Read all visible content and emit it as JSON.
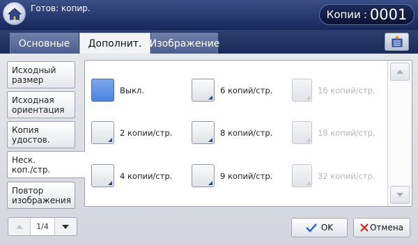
{
  "header": {
    "status": "Готов: копир.",
    "copies_label": "Копии",
    "copies_sep": ":",
    "copies_value": "0001"
  },
  "tabs": [
    {
      "label": "Основные"
    },
    {
      "label": "Дополнит."
    },
    {
      "label": "Изображение"
    }
  ],
  "side_menu": [
    {
      "label": "Исходный\nразмер"
    },
    {
      "label": "Исходная\nориентация"
    },
    {
      "label": "Копия\nудостов."
    },
    {
      "label": "Неск.\nкоп./стр."
    },
    {
      "label": "Повтор\nизображения"
    }
  ],
  "options": {
    "off": "Выкл.",
    "p2": "2 копии/стр.",
    "p4": "4 копии/стр.",
    "p6": "6 копий/стр.",
    "p8": "8 копий/стр.",
    "p9": "9 копий/стр.",
    "p16": "16 копий/стр.",
    "p18": "18 копий/стр.",
    "p32": "32 копий/стр."
  },
  "pager": {
    "page": "1/4"
  },
  "footer": {
    "ok": "OK",
    "cancel": "Отмена"
  },
  "colors": {
    "accent": "#4d84dc",
    "header": "#1a2a58",
    "cancel_x": "#d0241e",
    "ok_check": "#2a68c9"
  }
}
